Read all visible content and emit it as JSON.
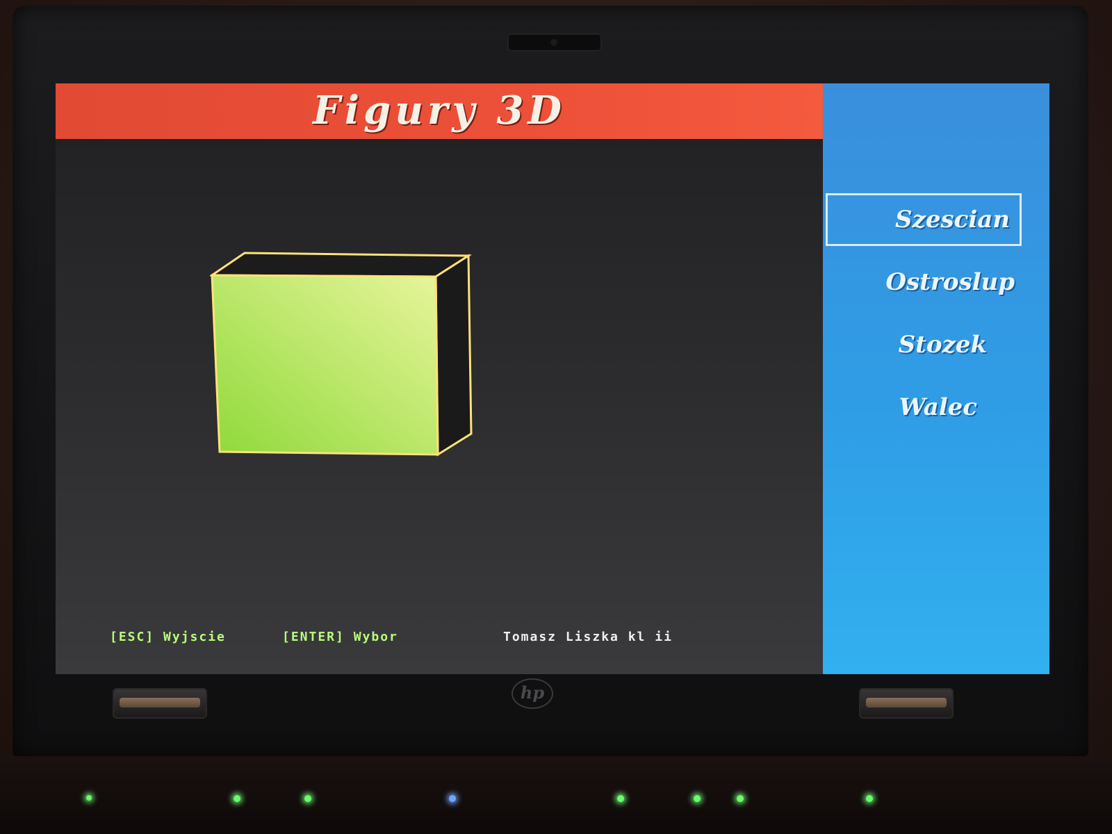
{
  "app": {
    "title": "Figury 3D"
  },
  "menu": {
    "selected_index": 0,
    "items": [
      {
        "label": "Szescian"
      },
      {
        "label": "Ostroslup"
      },
      {
        "label": "Stozek"
      },
      {
        "label": "Walec"
      }
    ]
  },
  "footer": {
    "esc_hint": "[ESC] Wyjscie",
    "enter_hint": "[ENTER] Wybor",
    "author": "Tomasz Liszka kl ii"
  },
  "shape": {
    "name": "cube-wireframe",
    "front_fill_from": "#8fd93a",
    "front_fill_to": "#e7f59a",
    "edge_color": "#ffe27a"
  },
  "colors": {
    "title_bar": "#e24a34",
    "menu_panel": "#2f9de6",
    "footer_hint": "#b8ff7a",
    "footer_author": "#f0f0f0"
  },
  "device": {
    "logo_text": "hp"
  },
  "icons": [
    "power-icon",
    "wireless-icon",
    "status-led-icon"
  ]
}
